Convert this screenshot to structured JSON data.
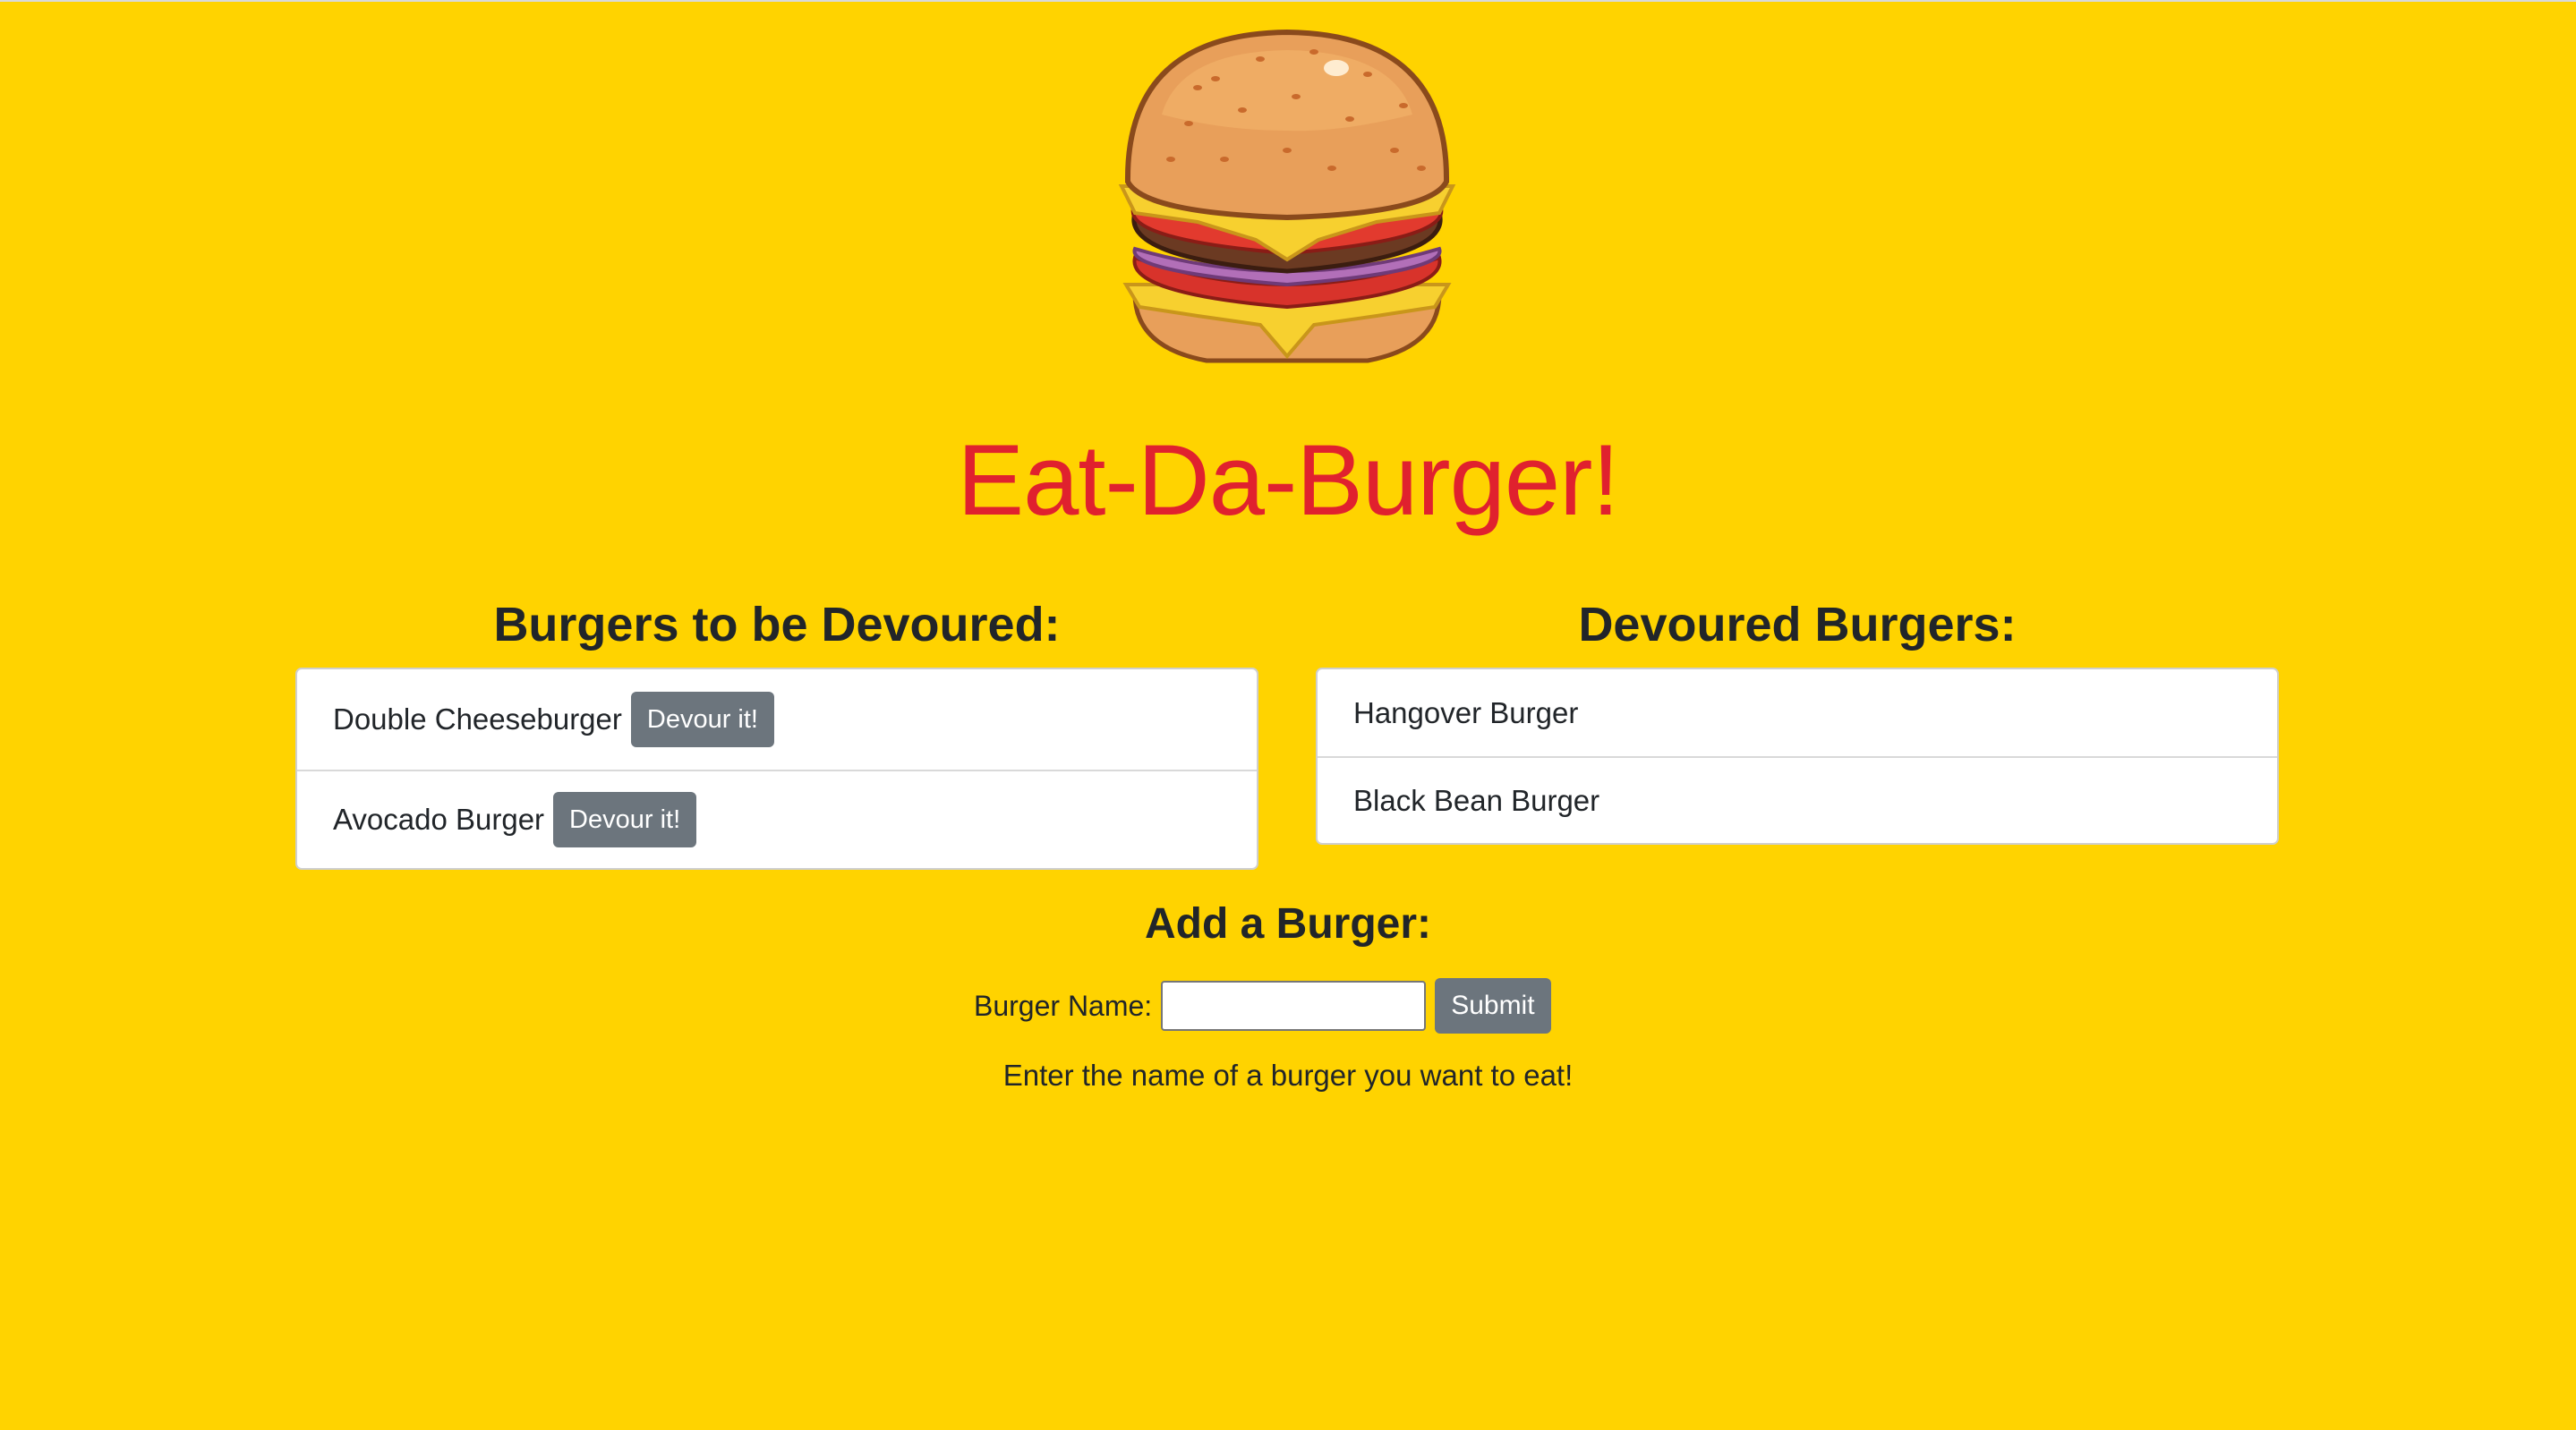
{
  "page": {
    "title": "Eat-Da-Burger!",
    "background_color": "#FFD300",
    "title_color": "#E0212E",
    "logo_icon": "hamburger-icon"
  },
  "todo": {
    "heading": "Burgers to be Devoured:",
    "items": [
      {
        "name": "Double Cheeseburger",
        "button": "Devour it!"
      },
      {
        "name": "Avocado Burger",
        "button": "Devour it!"
      }
    ]
  },
  "done": {
    "heading": "Devoured Burgers:",
    "items": [
      {
        "name": "Hangover Burger"
      },
      {
        "name": "Black Bean Burger"
      }
    ]
  },
  "add": {
    "heading": "Add a Burger:",
    "label": "Burger Name:",
    "input_value": "",
    "submit_label": "Submit",
    "hint": "Enter the name of a burger you want to eat!"
  },
  "colors": {
    "button": "#6C757D"
  }
}
